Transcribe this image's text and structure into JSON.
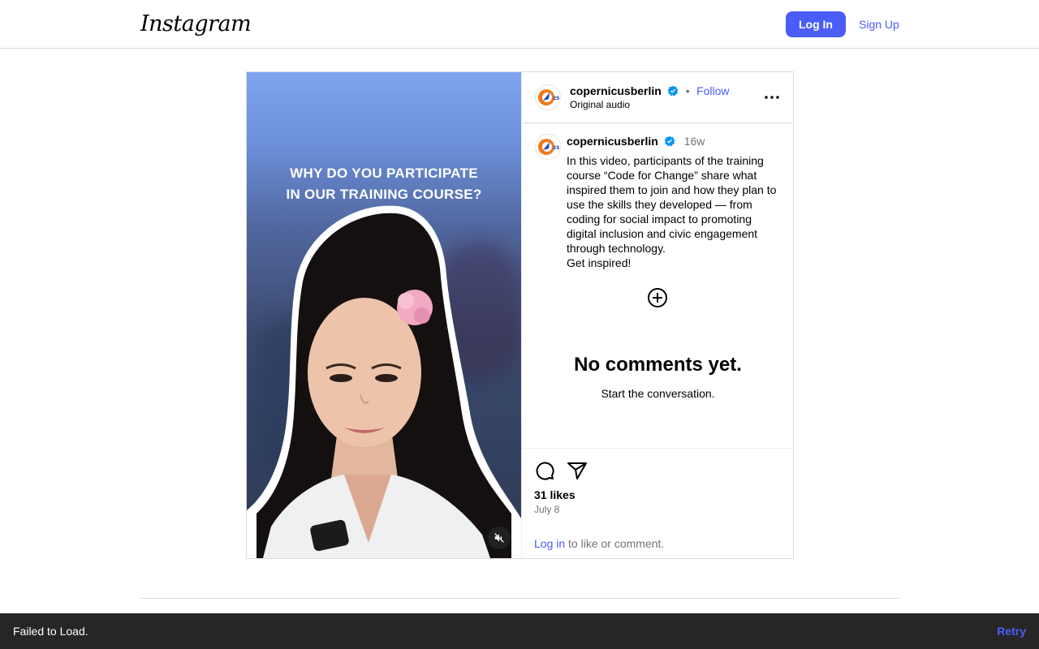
{
  "header": {
    "logo_text": "Instagram",
    "login_label": "Log In",
    "signup_label": "Sign Up"
  },
  "media": {
    "overlay_line1": "WHY DO YOU PARTICIPATE",
    "overlay_line2": "IN OUR TRAINING COURSE?",
    "mute_icon": "speaker-muted-icon"
  },
  "post": {
    "username": "copernicusberlin",
    "follow_label": "Follow",
    "separator": "•",
    "audio_label": "Original audio",
    "avatar_badge": "25",
    "caption_username": "copernicusberlin",
    "caption_time": "16w",
    "caption": "In this video, participants of the training course “Code for Change” share what inspired them to join and how they plan to use the skills they developed — from coding for social impact to promoting digital inclusion and civic engagement through technology.\nGet inspired!",
    "no_comments_title": "No comments yet.",
    "no_comments_sub": "Start the conversation.",
    "likes": "31 likes",
    "date": "July 8",
    "login_link": "Log in",
    "login_suffix": " to like or comment."
  },
  "toast": {
    "message": "Failed to Load.",
    "action": "Retry"
  },
  "colors": {
    "accent": "#4a5df9",
    "verified": "#0095f6",
    "toast_bg": "#262626"
  }
}
